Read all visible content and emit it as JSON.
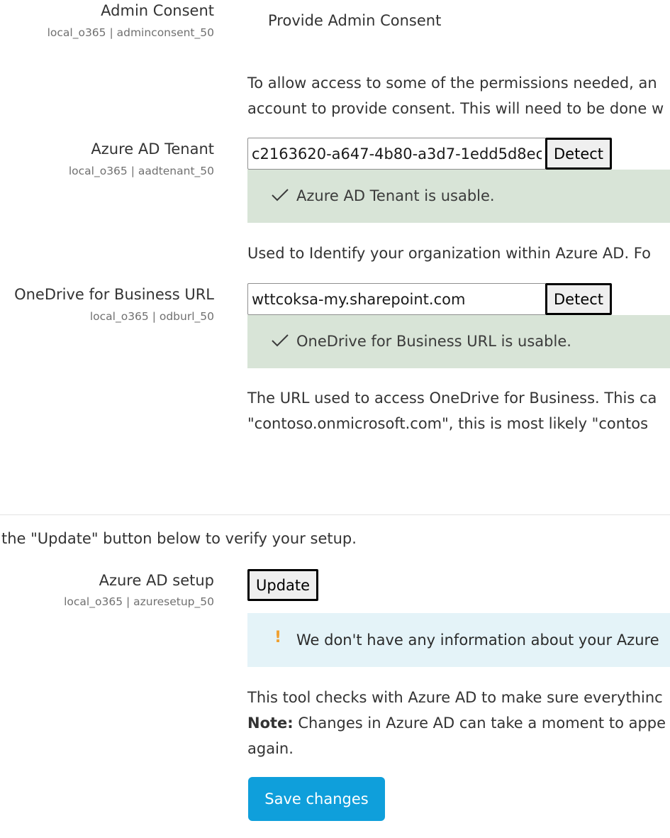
{
  "admin_consent": {
    "label": "Admin Consent",
    "setting_id": "local_o365 | adminconsent_50",
    "link_text": "Provide Admin Consent",
    "description_line1": "To allow access to some of the permissions needed, an",
    "description_line2": "account to provide consent. This will need to be done w"
  },
  "aad_tenant": {
    "label": "Azure AD Tenant",
    "setting_id": "local_o365 | aadtenant_50",
    "value": "c2163620-a647-4b80-a3d7-1edd5d8ec",
    "detect_label": "Detect",
    "status": "Azure AD Tenant is usable.",
    "description": "Used to Identify your organization within Azure AD. Fo"
  },
  "odb_url": {
    "label": "OneDrive for Business URL",
    "setting_id": "local_o365 | odburl_50",
    "value": "wttcoksa-my.sharepoint.com",
    "detect_label": "Detect",
    "status": "OneDrive for Business URL is usable.",
    "description_line1": "The URL used to access OneDrive for Business. This ca",
    "description_line2": "\"contoso.onmicrosoft.com\", this is most likely \"contos"
  },
  "verify_instructions": "the \"Update\" button below to verify your setup.",
  "azure_setup": {
    "label": "Azure AD setup",
    "setting_id": "local_o365 | azuresetup_50",
    "update_label": "Update",
    "warning": "We don't have any information about your Azure",
    "description_line1": "This tool checks with Azure AD to make sure everythinc",
    "note_label": "Note:",
    "note_text": " Changes in Azure AD can take a moment to appe",
    "description_line3": "again."
  },
  "save_button": "Save changes",
  "colors": {
    "primary": "#0f9fdb",
    "success_bg": "#d8e4d7",
    "info_bg": "#e4f3f8",
    "warning_icon": "#f0a030"
  },
  "icons": {
    "success": "checkmark-icon",
    "warning": "exclamation-icon"
  }
}
